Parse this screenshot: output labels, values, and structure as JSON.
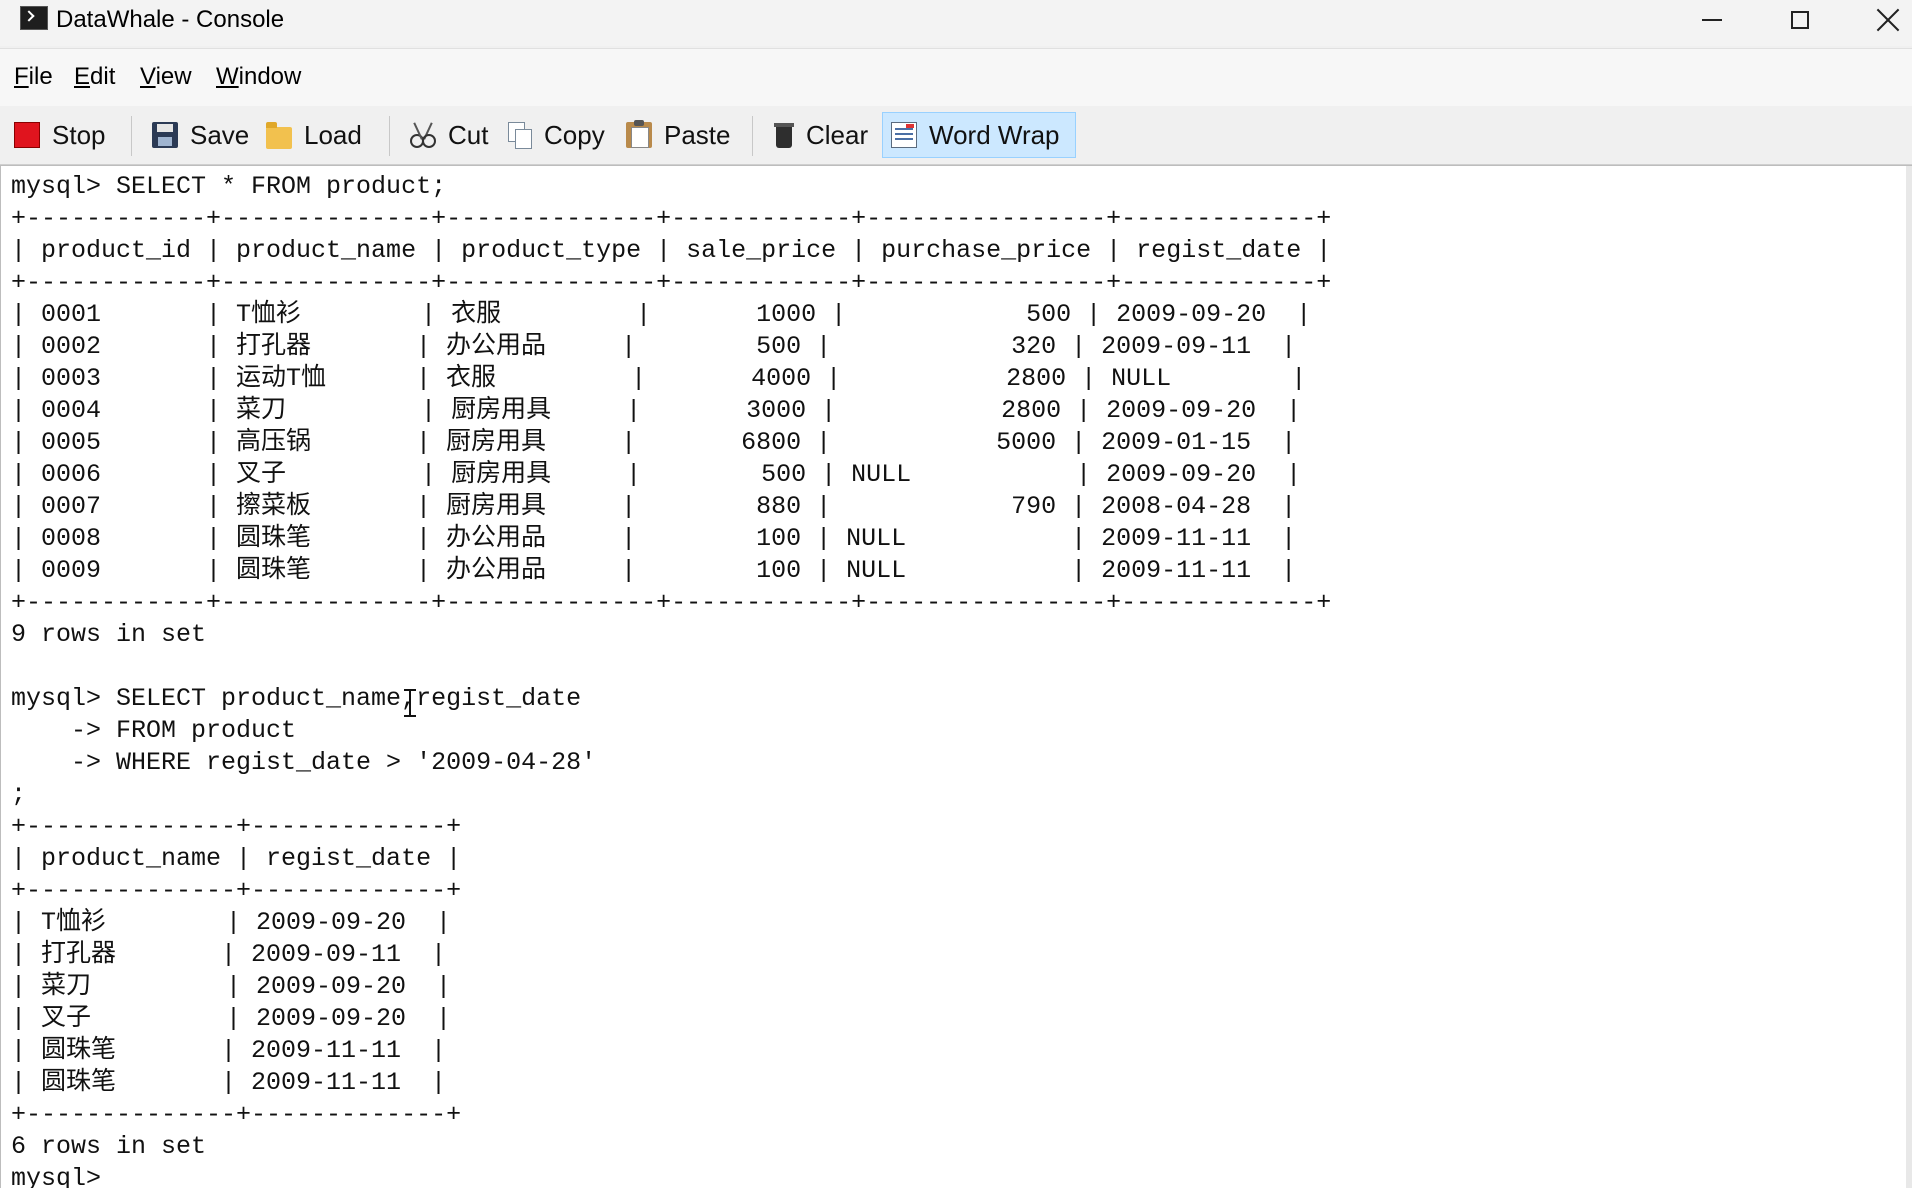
{
  "window": {
    "title": "DataWhale - Console",
    "controls": {
      "minimize": "minimize-icon",
      "maximize": "maximize-icon",
      "close": "close-icon"
    }
  },
  "menubar": {
    "items": [
      {
        "accel": "F",
        "rest": "ile"
      },
      {
        "accel": "E",
        "rest": "dit"
      },
      {
        "accel": "V",
        "rest": "iew"
      },
      {
        "accel": "W",
        "rest": "indow"
      }
    ]
  },
  "toolbar": {
    "stop": "Stop",
    "save": "Save",
    "load": "Load",
    "cut": "Cut",
    "copy": "Copy",
    "paste": "Paste",
    "clear": "Clear",
    "word_wrap": "Word Wrap",
    "word_wrap_active": true,
    "colors": {
      "stop": "#e0141e",
      "active_button_bg": "#cce8ff"
    }
  },
  "console": {
    "text": "mysql> SELECT * FROM product;\n+------------+--------------+--------------+------------+----------------+-------------+\n| product_id | product_name | product_type | sale_price | purchase_price | regist_date |\n+------------+--------------+--------------+------------+----------------+-------------+\n| 0001       | T恤衫        | 衣服         |       1000 |            500 | 2009-09-20  |\n| 0002       | 打孔器       | 办公用品     |        500 |            320 | 2009-09-11  |\n| 0003       | 运动T恤      | 衣服         |       4000 |           2800 | NULL        |\n| 0004       | 菜刀         | 厨房用具     |       3000 |           2800 | 2009-09-20  |\n| 0005       | 高压锅       | 厨房用具     |       6800 |           5000 | 2009-01-15  |\n| 0006       | 叉子         | 厨房用具     |        500 | NULL           | 2009-09-20  |\n| 0007       | 擦菜板       | 厨房用具     |        880 |            790 | 2008-04-28  |\n| 0008       | 圆珠笔       | 办公用品     |        100 | NULL           | 2009-11-11  |\n| 0009       | 圆珠笔       | 办公用品     |        100 | NULL           | 2009-11-11  |\n+------------+--------------+--------------+------------+----------------+-------------+\n9 rows in set\n\nmysql> SELECT product_name,regist_date\n    -> FROM product\n    -> WHERE regist_date > '2009-04-28'\n;\n+--------------+-------------+\n| product_name | regist_date |\n+--------------+-------------+\n| T恤衫        | 2009-09-20  |\n| 打孔器       | 2009-09-11  |\n| 菜刀         | 2009-09-20  |\n| 叉子         | 2009-09-20  |\n| 圆珠笔       | 2009-11-11  |\n| 圆珠笔       | 2009-11-11  |\n+--------------+-------------+\n6 rows in set\nmysql>"
  }
}
